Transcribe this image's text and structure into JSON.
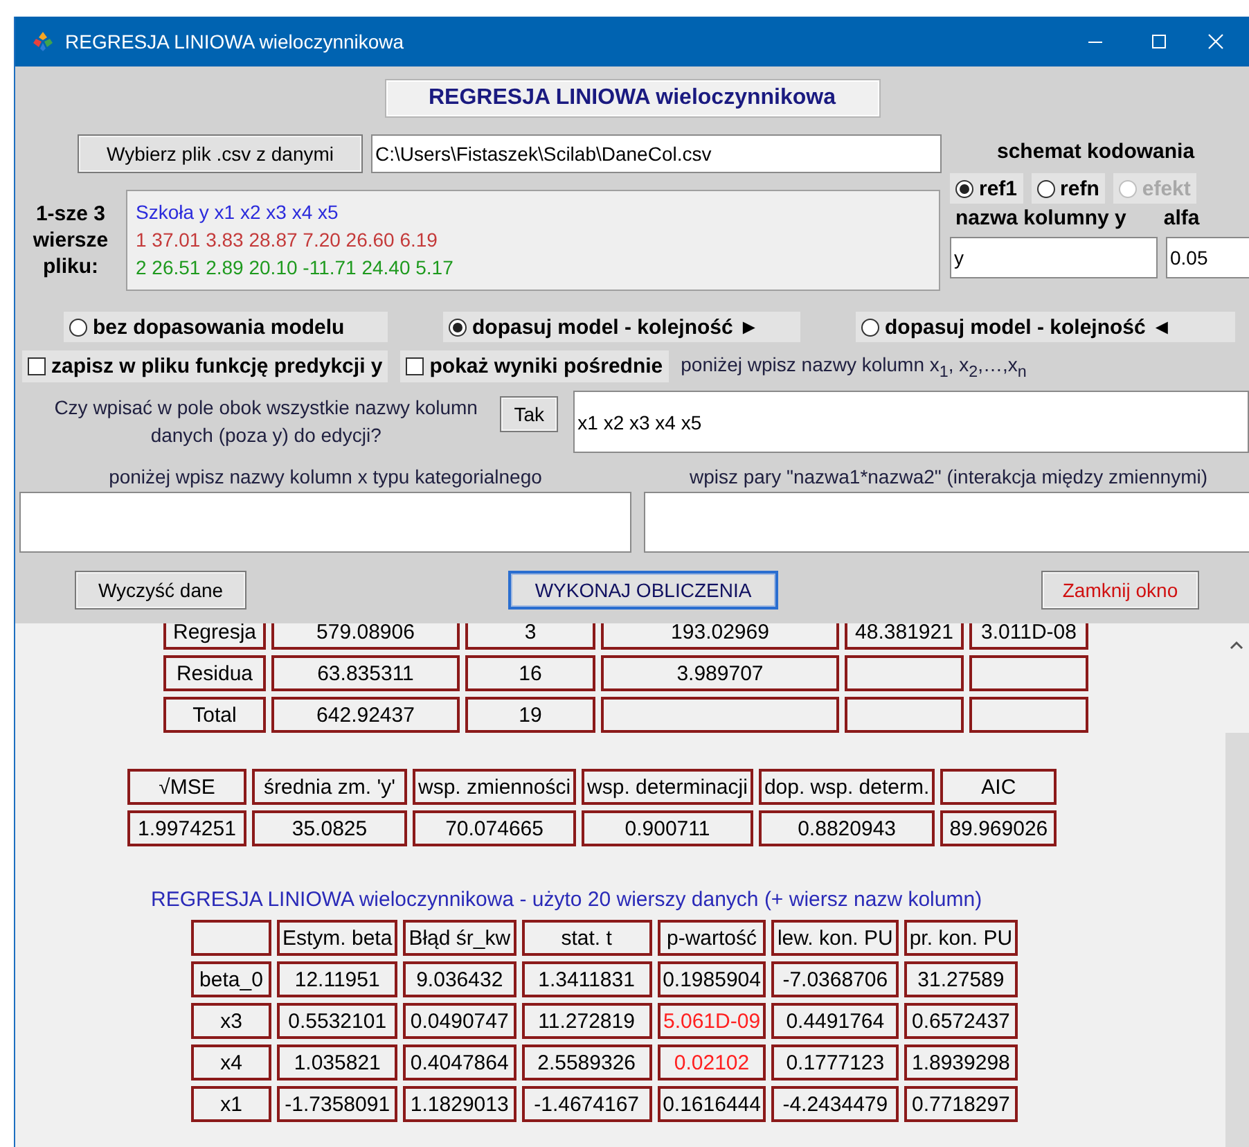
{
  "window": {
    "title": "REGRESJA LINIOWA wieloczynnikowa"
  },
  "header_label": "REGRESJA LINIOWA wieloczynnikowa",
  "file": {
    "button": "Wybierz plik .csv z danymi",
    "path": "C:\\Users\\Fistaszek\\Scilab\\DaneCol.csv"
  },
  "preview": {
    "label": "1-sze 3 wiersze pliku:",
    "lines": [
      {
        "text": "Szkoła y x1 x2 x3 x4 x5",
        "color": "#2b2bdc"
      },
      {
        "text": "1 37.01 3.83 28.87 7.20 26.60 6.19",
        "color": "#c43a3a"
      },
      {
        "text": "2 26.51 2.89 20.10 -11.71 24.40 5.17",
        "color": "#1e9a1e"
      }
    ]
  },
  "coding": {
    "title": "schemat kodowania",
    "options": [
      {
        "label": "ref1",
        "selected": true,
        "disabled": false
      },
      {
        "label": "refn",
        "selected": false,
        "disabled": false
      },
      {
        "label": "efekt",
        "selected": false,
        "disabled": true
      }
    ]
  },
  "y_column": {
    "label": "nazwa kolumny y",
    "value": "y"
  },
  "alpha": {
    "label": "alfa",
    "value": "0.05"
  },
  "model_options": [
    {
      "label": "bez dopasowania modelu",
      "selected": false
    },
    {
      "label": "dopasuj model - kolejność ►",
      "selected": true
    },
    {
      "label": "dopasuj model - kolejność ◄",
      "selected": false
    }
  ],
  "checkboxes": [
    {
      "label": "zapisz w pliku funkcję predykcji y",
      "checked": false
    },
    {
      "label": "pokaż wyniki pośrednie",
      "checked": false
    }
  ],
  "x_columns": {
    "hint": "poniżej wpisz nazwy kolumn x$_{1}$, x$_{2}$,…,x$_{n}$",
    "question": "Czy wpisać w pole obok wszystkie nazwy kolumn danych (poza y) do edycji?",
    "button": "Tak",
    "value": "x1 x2 x3 x4 x5"
  },
  "categorical": {
    "label": "poniżej wpisz nazwy kolumn x typu kategorialnego"
  },
  "interactions": {
    "label": "wpisz pary \"nazwa1*nazwa2\" (interakcja między zmiennymi)"
  },
  "buttons": [
    {
      "label": "Wyczyść dane",
      "kind": "normal"
    },
    {
      "label": "WYKONAJ OBLICZENIA",
      "kind": "default"
    },
    {
      "label": "Zamknij okno",
      "kind": "close"
    }
  ],
  "anova_table": {
    "rows": [
      [
        "Regresja",
        "579.08906",
        "3",
        "193.02969",
        "48.381921",
        "3.011D-08"
      ],
      [
        "Residua",
        "63.835311",
        "16",
        "3.989707",
        null,
        null
      ],
      [
        "Total",
        "642.92437",
        "19",
        null,
        null,
        null
      ]
    ]
  },
  "summary_table": {
    "columns": [
      "√MSE",
      "średnia zm. 'y'",
      "wsp. zmienności",
      "wsp. determinacji",
      "dop. wsp. determ.",
      "AIC"
    ],
    "values": [
      "1.9974251",
      "35.0825",
      "70.074665",
      "0.900711",
      "0.8820943",
      "89.969026"
    ]
  },
  "coef_title": "REGRESJA LINIOWA wieloczynnikowa - użyto 20 wierszy danych (+ wiersz nazw kolumn)",
  "coef_table": {
    "columns": [
      "Estym. beta",
      "Błąd śr_kw",
      "stat. t",
      "p-wartość",
      "lew. kon. PU",
      "pr. kon. PU"
    ],
    "rows": [
      {
        "name": "beta_0",
        "values": [
          "12.11951",
          "9.036432",
          "1.3411831",
          "0.1985904",
          "-7.0368706",
          "31.27589"
        ],
        "p_significant": false
      },
      {
        "name": "x3",
        "values": [
          "0.5532101",
          "0.0490747",
          "11.272819",
          "5.061D-09",
          "0.4491764",
          "0.6572437"
        ],
        "p_significant": true
      },
      {
        "name": "x4",
        "values": [
          "1.035821",
          "0.4047864",
          "2.5589326",
          "0.02102",
          "0.1777123",
          "1.8939298"
        ],
        "p_significant": true
      },
      {
        "name": "x1",
        "values": [
          "-1.7358091",
          "1.1829013",
          "-1.4674167",
          "0.1616444",
          "-4.2434479",
          "0.7718297"
        ],
        "p_significant": false
      }
    ]
  }
}
